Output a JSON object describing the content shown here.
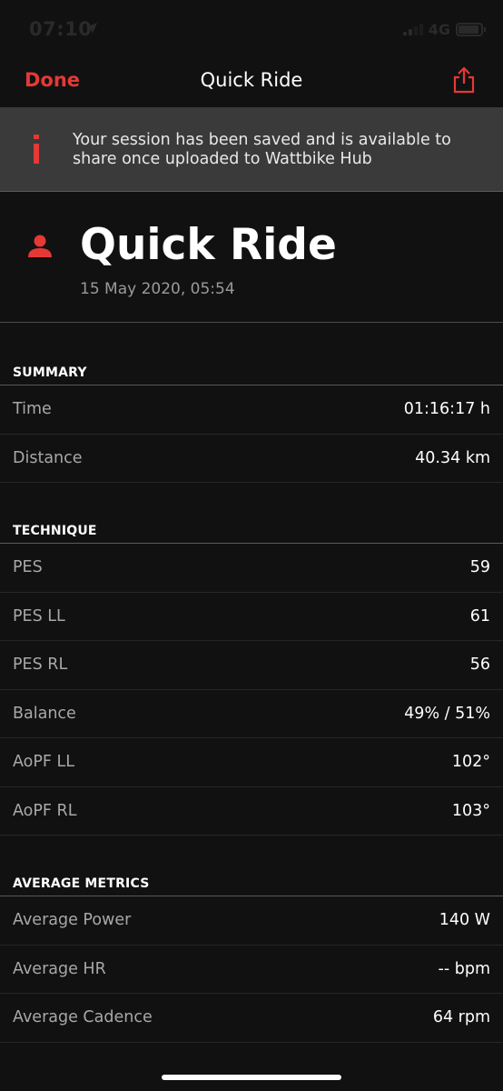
{
  "status_bar": {
    "time": "07:10",
    "network": "4G"
  },
  "nav": {
    "done_label": "Done",
    "title": "Quick Ride"
  },
  "banner": {
    "message": "Your session has been saved and is available to share once uploaded to Wattbike Hub"
  },
  "header": {
    "title": "Quick Ride",
    "date": "15 May 2020, 05:54"
  },
  "summary": {
    "title": "SUMMARY",
    "rows": [
      {
        "label": "Time",
        "value": "01:16:17 h"
      },
      {
        "label": "Distance",
        "value": "40.34 km"
      }
    ]
  },
  "technique": {
    "title": "TECHNIQUE",
    "rows": [
      {
        "label": "PES",
        "value": "59"
      },
      {
        "label": "PES LL",
        "value": "61"
      },
      {
        "label": "PES RL",
        "value": "56"
      },
      {
        "label": "Balance",
        "value": "49% / 51%"
      },
      {
        "label": "AoPF LL",
        "value": "102°"
      },
      {
        "label": "AoPF RL",
        "value": "103°"
      }
    ]
  },
  "average_metrics": {
    "title": "AVERAGE METRICS",
    "rows": [
      {
        "label": "Average Power",
        "value": "140 W"
      },
      {
        "label": "Average HR",
        "value": "-- bpm"
      },
      {
        "label": "Average Cadence",
        "value": "64 rpm"
      }
    ]
  },
  "colors": {
    "accent": "#e53935",
    "background": "#111111",
    "banner": "#3a3a3a"
  },
  "icons": {
    "share": "share-icon",
    "info": "info-icon",
    "person": "person-icon",
    "location": "location-arrow-icon"
  }
}
